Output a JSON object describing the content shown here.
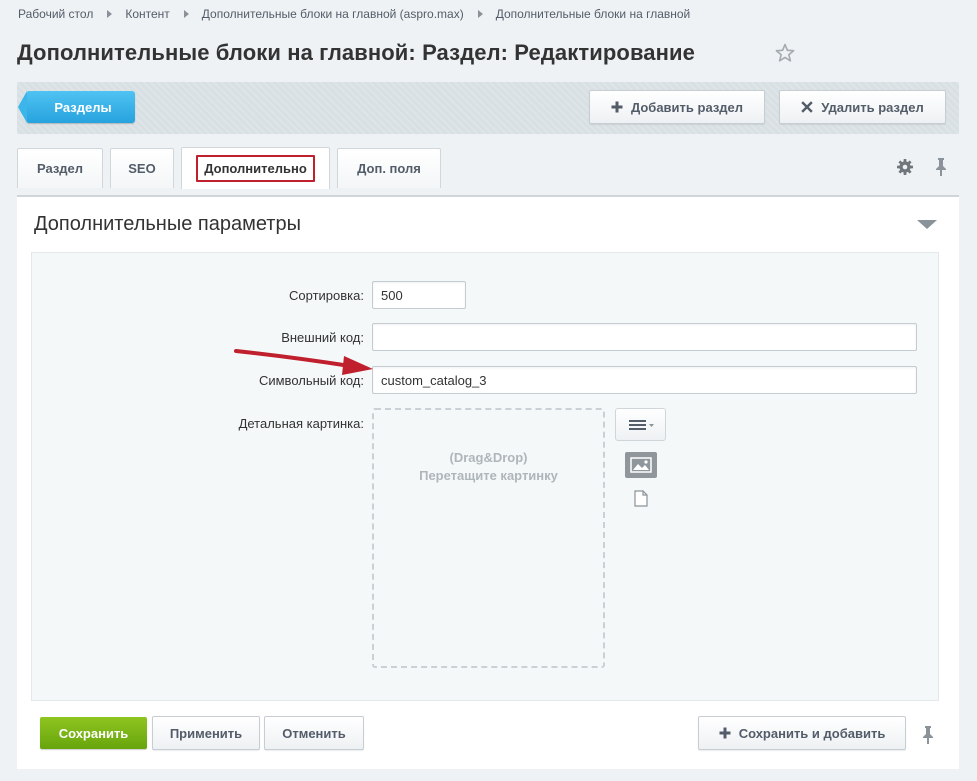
{
  "breadcrumb": [
    {
      "label": "Рабочий стол"
    },
    {
      "label": "Контент"
    },
    {
      "label": "Дополнительные блоки на главной (aspro.max)"
    },
    {
      "label": "Дополнительные блоки на главной"
    }
  ],
  "page_title": "Дополнительные блоки на главной: Раздел: Редактирование",
  "toolbar": {
    "sections_label": "Разделы",
    "add_section_label": "Добавить раздел",
    "delete_section_label": "Удалить раздел"
  },
  "tabs": [
    {
      "label": "Раздел"
    },
    {
      "label": "SEO"
    },
    {
      "label": "Дополнительно",
      "active": true
    },
    {
      "label": "Доп. поля"
    }
  ],
  "panel": {
    "title": "Дополнительные параметры"
  },
  "form": {
    "sort": {
      "label": "Сортировка:",
      "value": "500"
    },
    "external_code": {
      "label": "Внешний код:",
      "value": ""
    },
    "symbolic_code": {
      "label": "Символьный код:",
      "value": "custom_catalog_3"
    },
    "detail_picture": {
      "label": "Детальная картинка:",
      "dropzone_line1": "(Drag&Drop)",
      "dropzone_line2": "Перетащите картинку"
    }
  },
  "footer": {
    "save_label": "Сохранить",
    "apply_label": "Применить",
    "cancel_label": "Отменить",
    "save_and_add_label": "Сохранить и добавить"
  },
  "colors": {
    "accent_blue": "#27a3de",
    "save_green": "#67a50c",
    "highlight_red": "#c0202d",
    "arrow_red": "#c0202d"
  }
}
